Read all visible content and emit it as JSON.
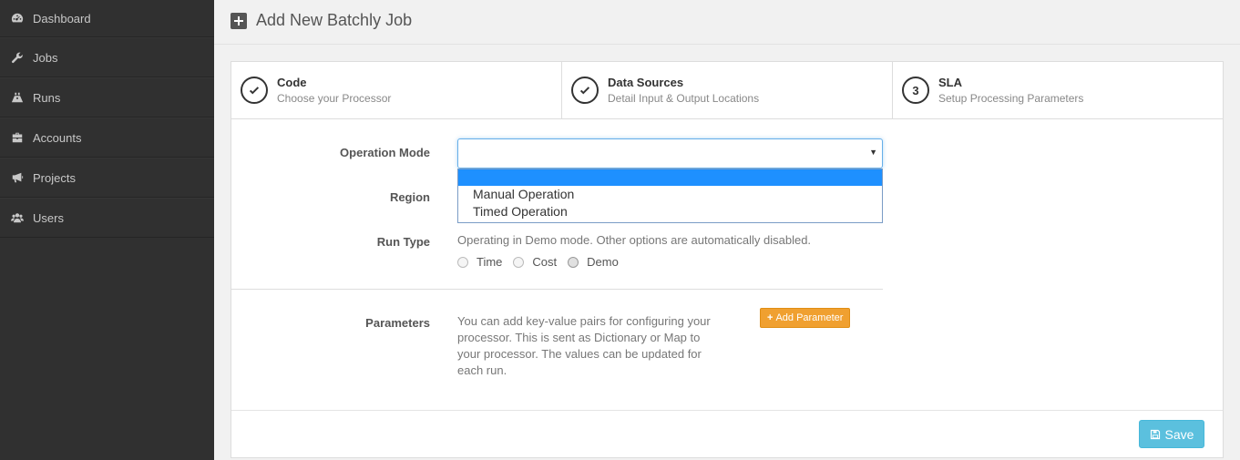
{
  "sidebar": {
    "items": [
      {
        "label": "Dashboard",
        "icon": "dashboard-icon"
      },
      {
        "label": "Jobs",
        "icon": "wrench-icon"
      },
      {
        "label": "Runs",
        "icon": "road-icon"
      },
      {
        "label": "Accounts",
        "icon": "briefcase-icon"
      },
      {
        "label": "Projects",
        "icon": "bullhorn-icon"
      },
      {
        "label": "Users",
        "icon": "users-icon"
      }
    ]
  },
  "header": {
    "title": "Add New Batchly Job",
    "icon": "plus-square-icon"
  },
  "wizard": {
    "steps": [
      {
        "title": "Code",
        "subtitle": "Choose your Processor",
        "status": "completed",
        "marker": ""
      },
      {
        "title": "Data Sources",
        "subtitle": "Detail Input & Output Locations",
        "status": "completed",
        "marker": ""
      },
      {
        "title": "SLA",
        "subtitle": "Setup Processing Parameters",
        "status": "current",
        "marker": "3"
      }
    ]
  },
  "form": {
    "operation_mode": {
      "label": "Operation Mode",
      "value": "",
      "options": [
        "",
        "Manual Operation",
        "Timed Operation"
      ]
    },
    "region": {
      "label": "Region"
    },
    "run_type": {
      "label": "Run Type",
      "help": "Operating in Demo mode. Other options are automatically disabled.",
      "options": [
        "Time",
        "Cost",
        "Demo"
      ],
      "selected": "Demo"
    },
    "parameters": {
      "label": "Parameters",
      "help_lines": [
        "You can add key-value pairs for configuring your",
        "processor. This is sent as Dictionary or Map to",
        "your processor. The values can be updated for",
        "each run."
      ],
      "add_button": "Add Parameter"
    }
  },
  "footer": {
    "save_label": "Save"
  },
  "colors": {
    "sidebar_bg": "#303030",
    "dropdown_highlight": "#1e90ff",
    "add_button": "#f0a030",
    "save_button": "#5bc0de"
  }
}
